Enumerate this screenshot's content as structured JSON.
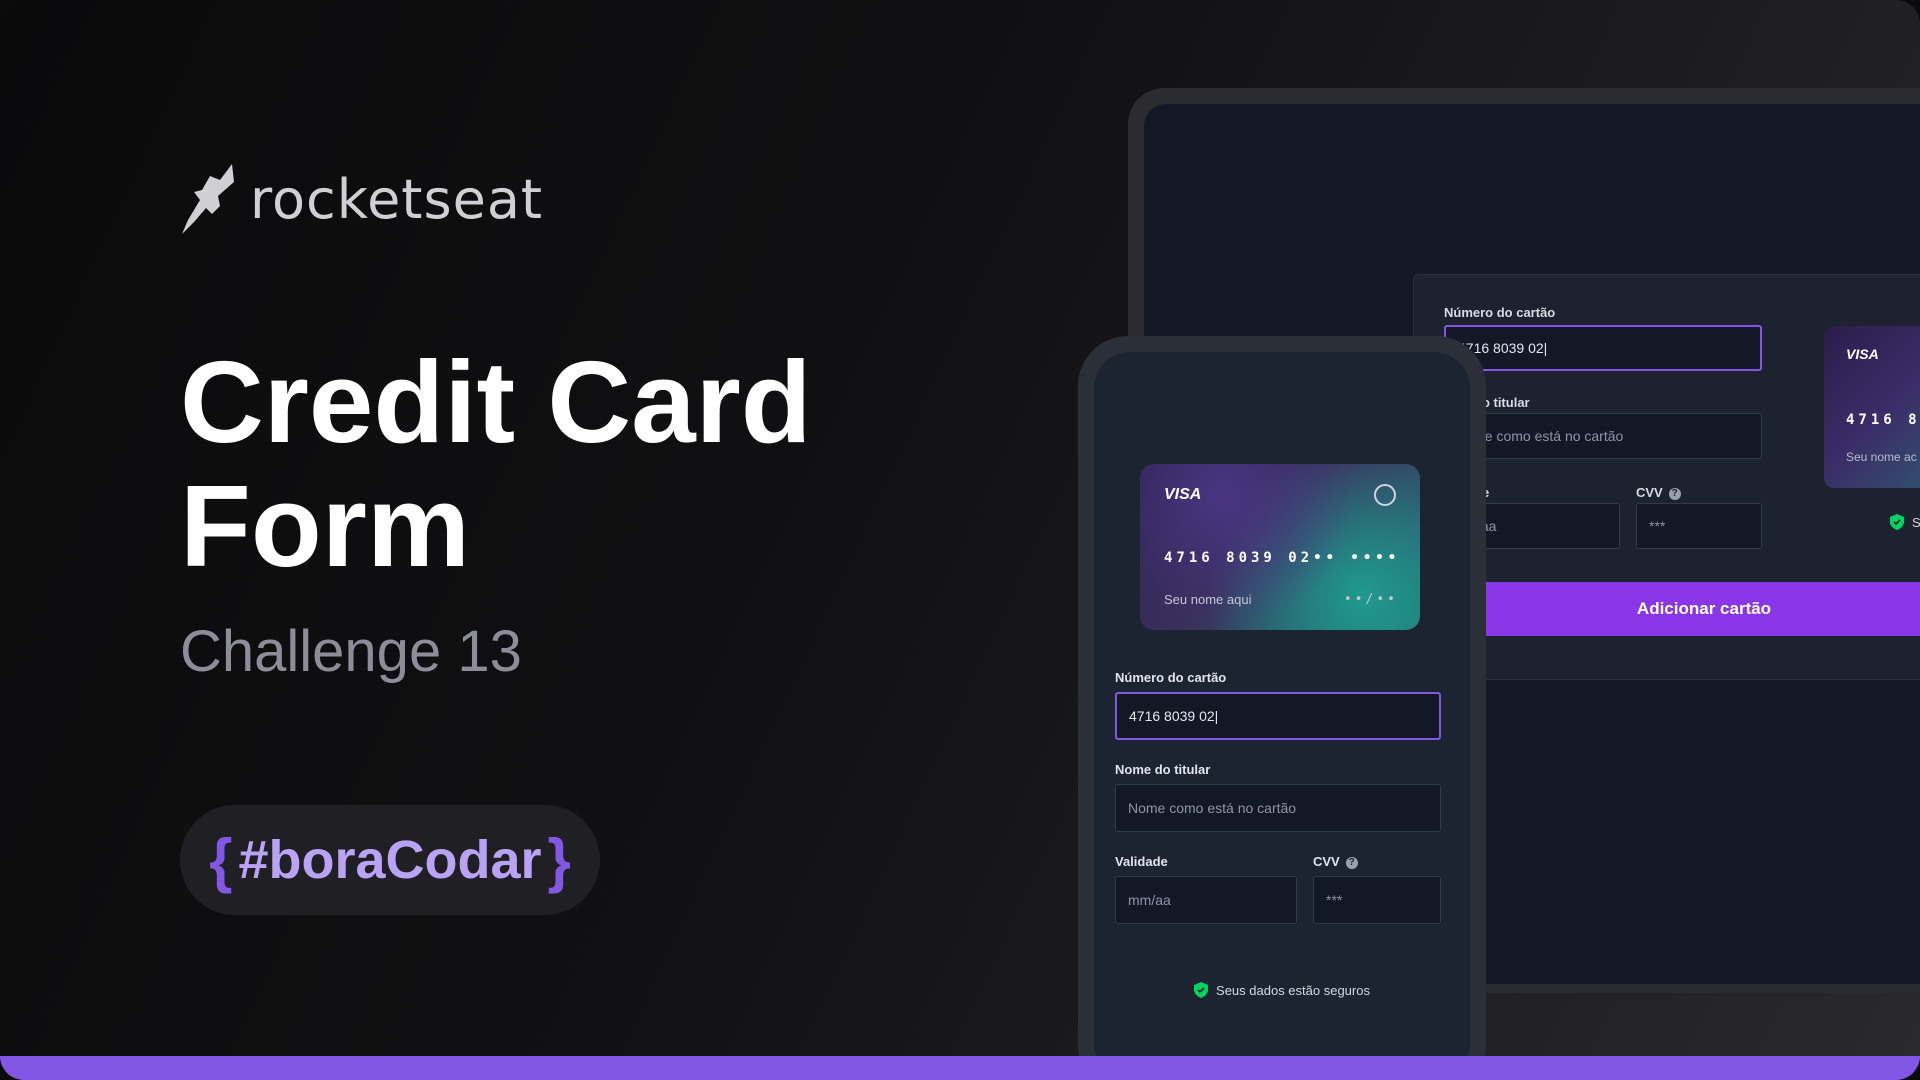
{
  "brand": {
    "logo_text": "rocketseat"
  },
  "hero": {
    "title_line1": "Credit Card",
    "title_line2": "Form",
    "subtitle": "Challenge 13",
    "tag_open": "{",
    "tag_text": "#boraCodar",
    "tag_close": "}"
  },
  "colors": {
    "accent": "#8257e5",
    "button": "#8a36e6",
    "secure_green": "#04d361"
  },
  "desktop": {
    "card_number_label": "Número do cartão",
    "card_number_value": "4716 8039 02|",
    "holder_label": "do titular",
    "holder_placeholder": "ne como está no cartão",
    "validity_label": "de",
    "validity_placeholder": "/aa",
    "cvv_label": "CVV",
    "cvv_placeholder": "***",
    "add_button": "Adicionar cartão",
    "card_brand": "VISA",
    "card_number_partial": "4716  8",
    "card_name_partial": "Seu nome ac",
    "secure_partial": "Seu"
  },
  "mobile": {
    "card": {
      "brand": "VISA",
      "number": "4716  8039  02••  ••••",
      "name": "Seu nome aqui",
      "expiry": "••/••"
    },
    "card_number_label": "Número do cartão",
    "card_number_value": "4716 8039 02|",
    "holder_label": "Nome do titular",
    "holder_placeholder": "Nome como está no cartão",
    "validity_label": "Validade",
    "validity_placeholder": "mm/aa",
    "cvv_label": "CVV",
    "cvv_placeholder": "***",
    "secure_text": "Seus dados estão seguros"
  }
}
